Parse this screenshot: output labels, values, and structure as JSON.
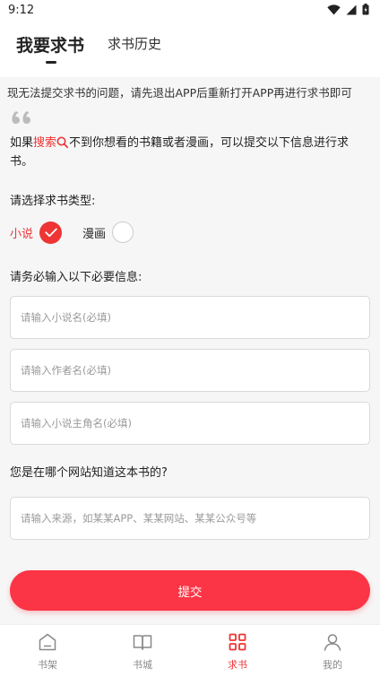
{
  "status_bar": {
    "time": "9:12"
  },
  "tabs": [
    {
      "label": "我要求书",
      "active": true
    },
    {
      "label": "求书历史",
      "active": false
    }
  ],
  "notice": "现无法提交求书的问题，请先退出APP后重新打开APP再进行求书即可",
  "intro": {
    "before": "如果",
    "search_word": "搜索",
    "after": "不到你想看的书籍或者漫画，可以提交以下信息进行求书。"
  },
  "type_section": {
    "label": "请选择求书类型:",
    "options": [
      {
        "label": "小说",
        "selected": true
      },
      {
        "label": "漫画",
        "selected": false
      }
    ]
  },
  "required_section": {
    "label": "请务必输入以下必要信息:",
    "fields": [
      {
        "placeholder": "请输入小说名(必填)",
        "value": ""
      },
      {
        "placeholder": "请输入作者名(必填)",
        "value": ""
      },
      {
        "placeholder": "请输入小说主角名(必填)",
        "value": ""
      }
    ]
  },
  "source_section": {
    "label": "您是在哪个网站知道这本书的?",
    "placeholder": "请输入来源，如某某APP、某某网站、某某公众号等"
  },
  "submit_label": "提交",
  "bottom_nav": [
    {
      "label": "书架",
      "icon": "bookshelf-icon",
      "active": false
    },
    {
      "label": "书城",
      "icon": "book-icon",
      "active": false
    },
    {
      "label": "求书",
      "icon": "grid-icon",
      "active": true
    },
    {
      "label": "我的",
      "icon": "person-icon",
      "active": false
    }
  ],
  "colors": {
    "accent": "#ee3434",
    "button": "#fb3545",
    "background": "#f6f6f6"
  }
}
